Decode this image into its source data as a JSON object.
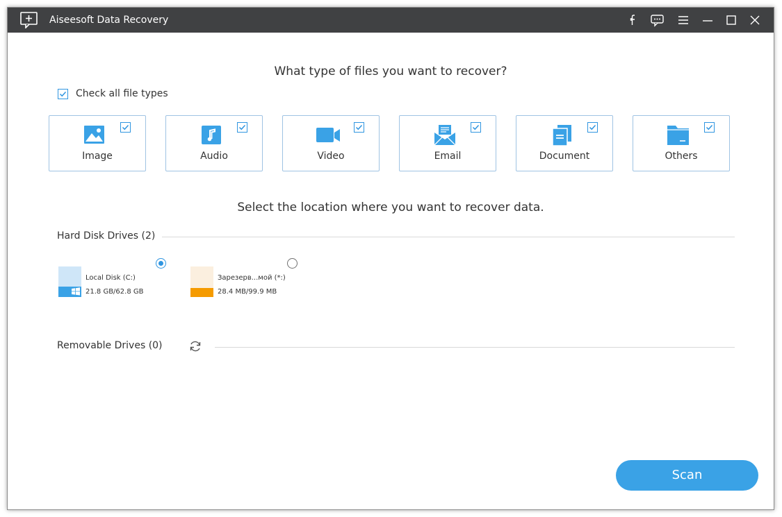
{
  "window": {
    "title": "Aiseesoft Data Recovery",
    "titlebar_buttons": [
      "facebook-icon",
      "feedback-icon",
      "menu-icon",
      "minimize-icon",
      "maximize-icon",
      "close-icon"
    ]
  },
  "file_types": {
    "heading": "What type of files you want to recover?",
    "check_all_label": "Check all file types",
    "check_all_checked": true,
    "items": [
      {
        "label": "Image",
        "icon": "image-icon",
        "checked": true
      },
      {
        "label": "Audio",
        "icon": "audio-icon",
        "checked": true
      },
      {
        "label": "Video",
        "icon": "video-icon",
        "checked": true
      },
      {
        "label": "Email",
        "icon": "email-icon",
        "checked": true
      },
      {
        "label": "Document",
        "icon": "document-icon",
        "checked": true
      },
      {
        "label": "Others",
        "icon": "folder-icon",
        "checked": true
      }
    ]
  },
  "location": {
    "heading": "Select the location where you want to recover data.",
    "hard_disk_title": "Hard Disk Drives (2)",
    "drives": [
      {
        "name": "Local Disk (C:)",
        "size": "21.8 GB/62.8 GB",
        "selected": true,
        "icon": "windows-drive-icon"
      },
      {
        "name": "Зарезерв...мой (*:)",
        "size": "28.4 MB/99.9 MB",
        "selected": false,
        "icon": "drive-icon"
      }
    ],
    "removable_title": "Removable Drives (0)"
  },
  "actions": {
    "scan_label": "Scan"
  },
  "colors": {
    "accent": "#2f95e0",
    "titlebar": "#404143",
    "scan_button": "#3aa2e6",
    "reserved_drive": "#f59b00"
  }
}
